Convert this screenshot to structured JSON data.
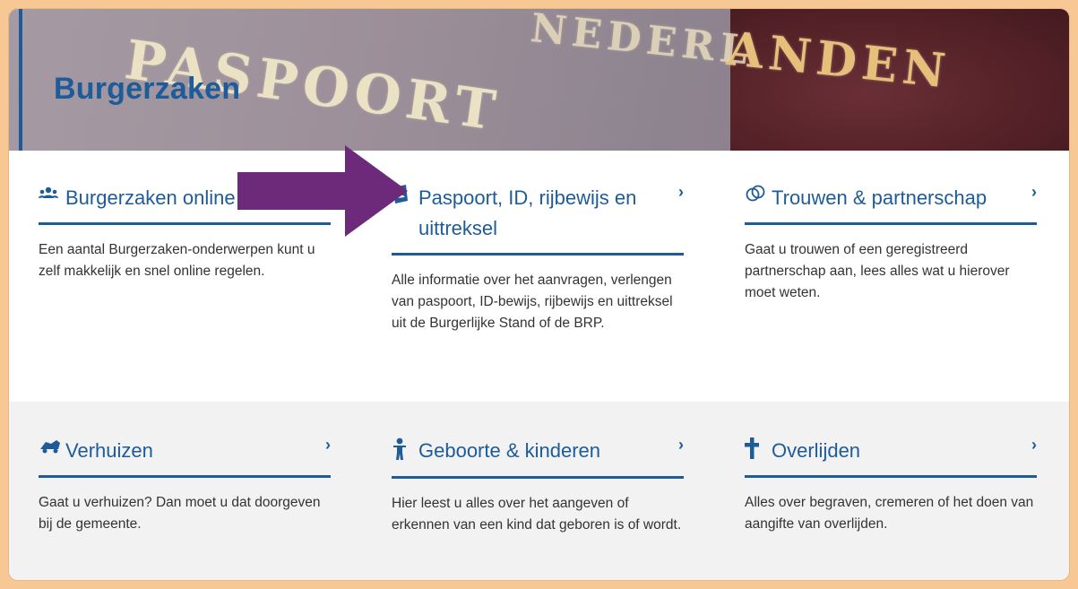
{
  "hero": {
    "title": "Burgerzaken",
    "bg_words": {
      "paspoort": "PASPOORT",
      "nederlanden": "NEDERL",
      "nederlanden_right": "ANDEN"
    }
  },
  "colors": {
    "accent": "#1d5c99",
    "frame": "#f7c894",
    "arrow": "#6e2a7a",
    "row_alt": "#f2f2f2"
  },
  "cards": [
    {
      "icon": "people-icon",
      "title": "Burgerzaken online",
      "chevron": "›",
      "text": "Een aantal Burgerzaken-onderwerpen kunt u zelf makkelijk en snel online regelen."
    },
    {
      "icon": "passport-icon",
      "title": "Paspoort, ID, rijbewijs en uittreksel",
      "chevron": "›",
      "text": "Alle informatie over het aanvragen, verlengen van paspoort, ID-bewijs, rijbewijs en uittreksel uit de Burgerlijke Stand of de BRP."
    },
    {
      "icon": "rings-icon",
      "title": "Trouwen & partnerschap",
      "chevron": "›",
      "text": "Gaat u trouwen of een geregistreerd partnerschap aan, lees alles wat u hierover moet weten."
    },
    {
      "icon": "moving-truck-icon",
      "title": "Verhuizen",
      "chevron": "›",
      "text": "Gaat u verhuizen? Dan moet u dat doorgeven bij de gemeente."
    },
    {
      "icon": "child-icon",
      "title": "Geboorte & kinderen",
      "chevron": "›",
      "text": "Hier leest u alles over het aangeven of erkennen van een kind dat geboren is of wordt."
    },
    {
      "icon": "cross-icon",
      "title": "Overlijden",
      "chevron": "›",
      "text": "Alles over begraven, cremeren of het doen van aangifte van overlijden."
    }
  ]
}
